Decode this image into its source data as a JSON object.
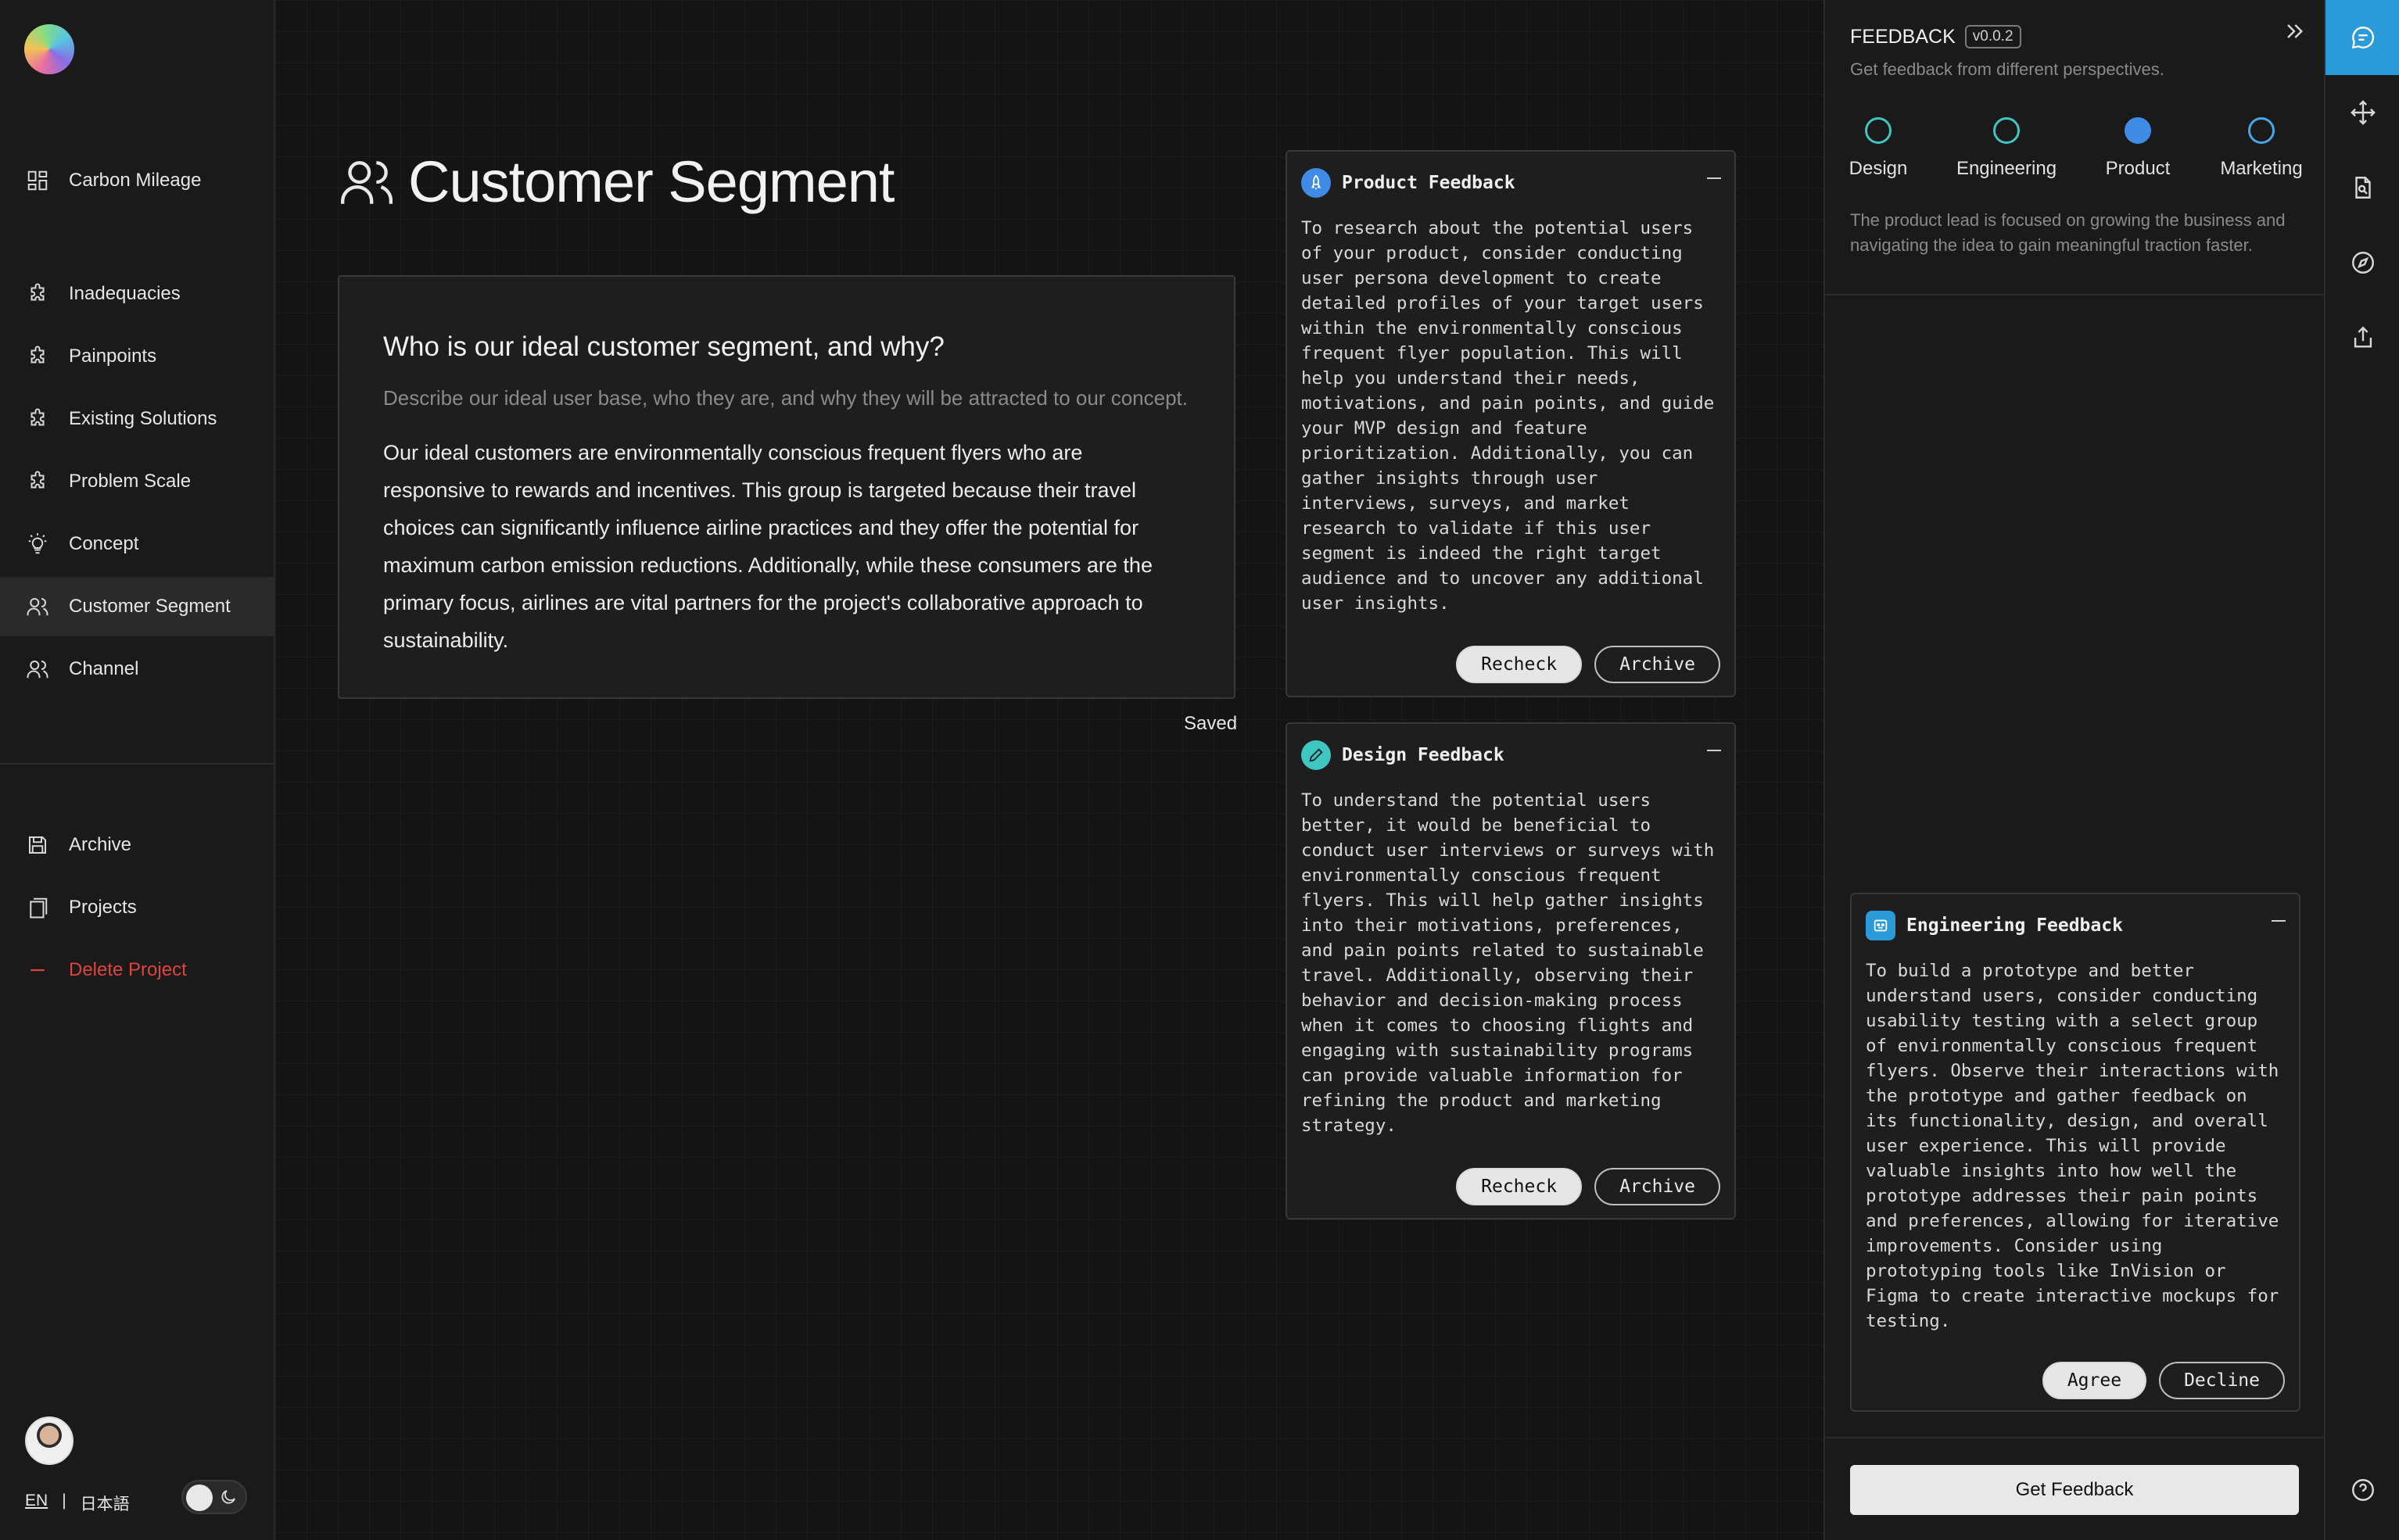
{
  "sidebar": {
    "top_item": {
      "label": "Carbon Mileage",
      "icon": "dashboard-icon"
    },
    "items": [
      {
        "label": "Inadequacies",
        "icon": "puzzle-icon"
      },
      {
        "label": "Painpoints",
        "icon": "puzzle-icon"
      },
      {
        "label": "Existing Solutions",
        "icon": "puzzle-icon"
      },
      {
        "label": "Problem Scale",
        "icon": "puzzle-icon"
      },
      {
        "label": "Concept",
        "icon": "lightbulb-icon"
      },
      {
        "label": "Customer Segment",
        "icon": "users-icon",
        "active": true
      },
      {
        "label": "Channel",
        "icon": "users-icon"
      }
    ],
    "bottom_items": [
      {
        "label": "Archive",
        "icon": "save-icon"
      },
      {
        "label": "Projects",
        "icon": "copy-icon"
      },
      {
        "label": "Delete Project",
        "icon": "minus-icon"
      }
    ],
    "lang_en": "EN",
    "lang_divider": "|",
    "lang_ja": "日本語"
  },
  "main": {
    "title": "Customer Segment",
    "question": "Who is our ideal customer segment, and why?",
    "description": "Describe our ideal user base, who they are, and why they will be attracted to our concept.",
    "answer": "Our ideal customers are environmentally conscious frequent flyers who are responsive to rewards and incentives. This group is targeted because their travel choices can significantly influence airline practices and they offer the potential for maximum carbon emission reductions. Additionally, while these consumers are the primary focus, airlines are vital partners for the project's collaborative approach to sustainability.",
    "saved_label": "Saved"
  },
  "product_feedback": {
    "title": "Product Feedback",
    "body": "To research about the potential users of your product, consider conducting user persona development to create detailed profiles of your target users within the environmentally conscious frequent flyer population. This will help you understand their needs, motivations, and pain points, and guide your MVP design and feature prioritization. Additionally, you can gather insights through user interviews, surveys, and market research to validate if this user segment is indeed the right target audience and to uncover any additional user insights.",
    "recheck": "Recheck",
    "archive": "Archive"
  },
  "design_feedback": {
    "title": "Design Feedback",
    "body": "To understand the potential users better, it would be beneficial to conduct user interviews or surveys with environmentally conscious frequent flyers. This will help gather insights into their motivations, preferences, and pain points related to sustainable travel. Additionally, observing their behavior and decision-making process when it comes to choosing flights and engaging with sustainability programs can provide valuable information for refining the product and marketing strategy.",
    "recheck": "Recheck",
    "archive": "Archive"
  },
  "panel": {
    "title": "FEEDBACK",
    "version": "v0.0.2",
    "subtitle": "Get feedback from different perspectives.",
    "perspectives": [
      {
        "label": "Design",
        "selected": false
      },
      {
        "label": "Engineering",
        "selected": false
      },
      {
        "label": "Product",
        "selected": true
      },
      {
        "label": "Marketing",
        "selected": false
      }
    ],
    "perspective_description": "The product lead is focused on growing the business and navigating the idea to gain meaningful traction faster.",
    "engineering_feedback": {
      "title": "Engineering Feedback",
      "body": "To build a prototype and better understand users, consider conducting usability testing with a select group of environmentally conscious frequent flyers. Observe their interactions with the prototype and gather feedback on its functionality, design, and overall user experience. This will provide valuable insights into how well the prototype addresses their pain points and preferences, allowing for iterative improvements. Consider using prototyping tools like InVision or Figma to create interactive mockups for testing.",
      "agree": "Agree",
      "decline": "Decline"
    },
    "get_feedback": "Get Feedback"
  },
  "rail": {
    "icons": [
      "chat-icon",
      "move-icon",
      "document-search-icon",
      "compass-icon",
      "share-icon",
      "help-icon"
    ]
  },
  "colors": {
    "accent": "#2b9ad9",
    "danger": "#e0443e",
    "product_badge": "#3f8be6",
    "design_badge": "#3fc6c0"
  }
}
